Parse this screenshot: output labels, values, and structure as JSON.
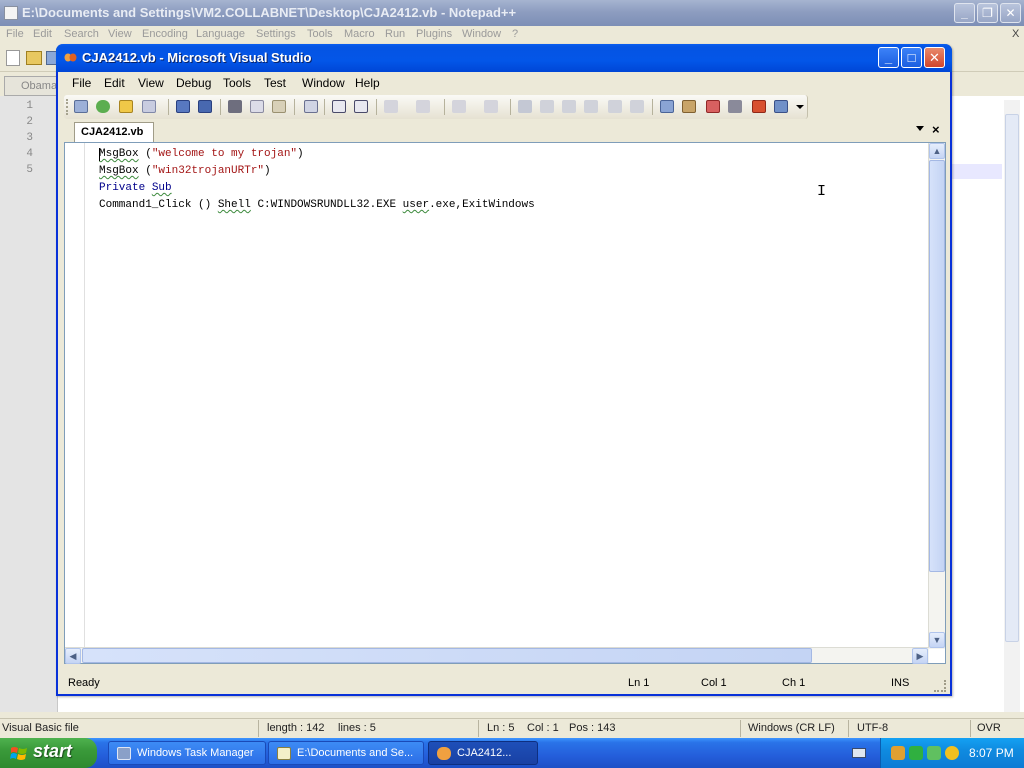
{
  "notepadpp": {
    "title": "E:\\Documents and Settings\\VM2.COLLABNET\\Desktop\\CJA2412.vb - Notepad++",
    "menu": [
      "File",
      "Edit",
      "Search",
      "View",
      "Encoding",
      "Language",
      "Settings",
      "Tools",
      "Macro",
      "Run",
      "Plugins",
      "Window",
      "?"
    ],
    "tab_label": "Obama",
    "line_numbers": [
      "1",
      "2",
      "3",
      "4",
      "5"
    ],
    "status": {
      "file_type": "Visual Basic file",
      "length": "length : 142",
      "lines": "lines : 5",
      "ln": "Ln : 5",
      "col": "Col : 1",
      "pos": "Pos : 143",
      "eol": "Windows (CR LF)",
      "encoding": "UTF-8",
      "mode": "OVR"
    },
    "close_mark": "X"
  },
  "vs": {
    "title": "CJA2412.vb - Microsoft Visual Studio",
    "menu": [
      "File",
      "Edit",
      "View",
      "Debug",
      "Tools",
      "Test",
      "Window",
      "Help"
    ],
    "doc_tab": "CJA2412.vb",
    "doc_close": "×",
    "code": [
      {
        "a": "MsgBox",
        "b": " (",
        "c": "\"welcome to my trojan\"",
        "d": ")"
      },
      {
        "a": "MsgBox",
        "b": " (",
        "c": "\"win32trojanURTr\"",
        "d": ")"
      },
      {
        "a": "Private",
        "b": " ",
        "c": "Sub",
        "d": ""
      },
      {
        "a": "Command1_Click () ",
        "b": "Shell",
        "c": " C:WINDOWSRUNDLL32.EXE ",
        "d": "user",
        "e": ".exe,ExitWindows"
      }
    ],
    "status": {
      "ready": "Ready",
      "ln": "Ln 1",
      "col": "Col 1",
      "ch": "Ch 1",
      "ins": "INS"
    }
  },
  "taskbar": {
    "start": "start",
    "tasks": [
      "Windows Task Manager",
      "E:\\Documents and Se...",
      "CJA2412..."
    ],
    "clock": "8:07 PM"
  }
}
